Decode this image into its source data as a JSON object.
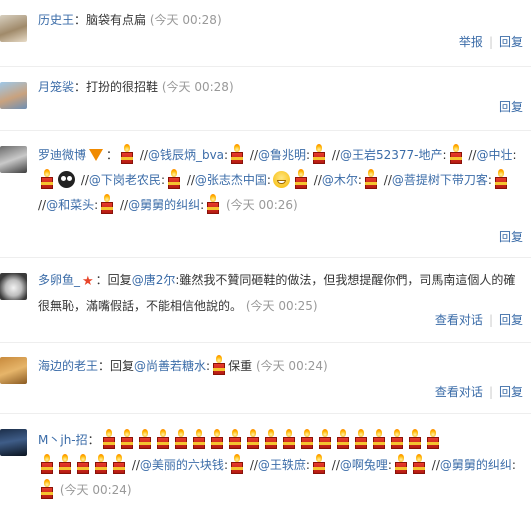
{
  "comments": [
    {
      "name": "历史王",
      "text": "：脑袋有点扁",
      "time": "(今天 00:28)",
      "actions": [
        "举报",
        "回复"
      ]
    },
    {
      "name": "月笼裟",
      "text": "：打扮的很招鞋",
      "time": "(今天 00:28)",
      "actions": [
        "回复"
      ]
    },
    {
      "name": "罗迪微博",
      "colon": "：",
      "sep": "//",
      "mentions": [
        "@钱辰炳_bva",
        "@鲁兆明",
        "@王岩52377-地产",
        "@中壮",
        "@下岗老农民",
        "@张志杰中国",
        "@木尔",
        "@菩提树下带刀客",
        "@和菜头",
        "@舅舅的纠纠"
      ],
      "time": "(今天 00:26)",
      "actions": [
        "回复"
      ]
    },
    {
      "name": "多卵鱼_",
      "reply_prefix": "：回复",
      "reply_to": "@唐2尔",
      "text": ":雖然我不贊同砸鞋的做法，但我想提醒你們，司馬南這個人的確很無恥，滿嘴假話，不能相信他說的。",
      "time": "(今天 00:25)",
      "actions": [
        "查看对话",
        "回复"
      ]
    },
    {
      "name": "海边的老王",
      "reply_prefix": "：回复",
      "reply_to": "@尚善若糖水",
      "text": "保重",
      "time": "(今天 00:24)",
      "actions": [
        "查看对话",
        "回复"
      ]
    },
    {
      "name": "M丶jh-招",
      "colon": "：",
      "sep": "//",
      "mentions": [
        "@美丽的六块钱",
        "@王轶庶",
        "@啊兔哩",
        "@舅舅的纠纠"
      ],
      "time": "(今天 00:24)"
    }
  ]
}
